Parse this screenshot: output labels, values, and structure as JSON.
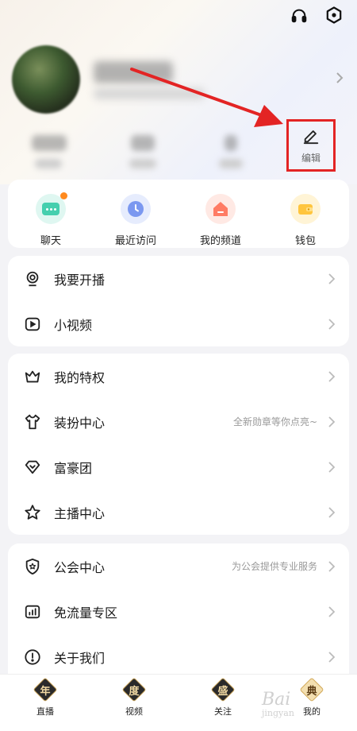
{
  "header": {
    "icons": [
      "headphone-icon",
      "settings-hex-icon"
    ]
  },
  "profile": {
    "edit_label": "编辑",
    "annotation_color": "#e32424"
  },
  "quick_actions": [
    {
      "label": "聊天",
      "icon": "chat-icon",
      "color": "#5fd6b8",
      "has_dot": true
    },
    {
      "label": "最近访问",
      "icon": "clock-icon",
      "color": "#7b98f0"
    },
    {
      "label": "我的频道",
      "icon": "home-icon",
      "color": "#ff7b64"
    },
    {
      "label": "钱包",
      "icon": "wallet-icon",
      "color": "#ffc53d"
    }
  ],
  "section1": [
    {
      "title": "我要开播",
      "icon": "broadcast-icon"
    },
    {
      "title": "小视频",
      "icon": "video-icon"
    }
  ],
  "section2": [
    {
      "title": "我的特权",
      "icon": "crown-icon"
    },
    {
      "title": "装扮中心",
      "icon": "shirt-icon",
      "hint": "全新勋章等你点亮~"
    },
    {
      "title": "富豪团",
      "icon": "diamond-icon"
    },
    {
      "title": "主播中心",
      "icon": "star-icon"
    }
  ],
  "section3": [
    {
      "title": "公会中心",
      "icon": "shield-icon",
      "hint": "为公会提供专业服务"
    },
    {
      "title": "免流量专区",
      "icon": "chart-icon"
    },
    {
      "title": "关于我们",
      "icon": "info-icon"
    }
  ],
  "tabbar": [
    {
      "label": "直播",
      "char": "年"
    },
    {
      "label": "视频",
      "char": "度"
    },
    {
      "label": "关注",
      "char": "盛"
    },
    {
      "label": "我的",
      "char": "典",
      "active": true
    }
  ],
  "watermark": {
    "text": "Bai",
    "sub": "jingyan"
  }
}
